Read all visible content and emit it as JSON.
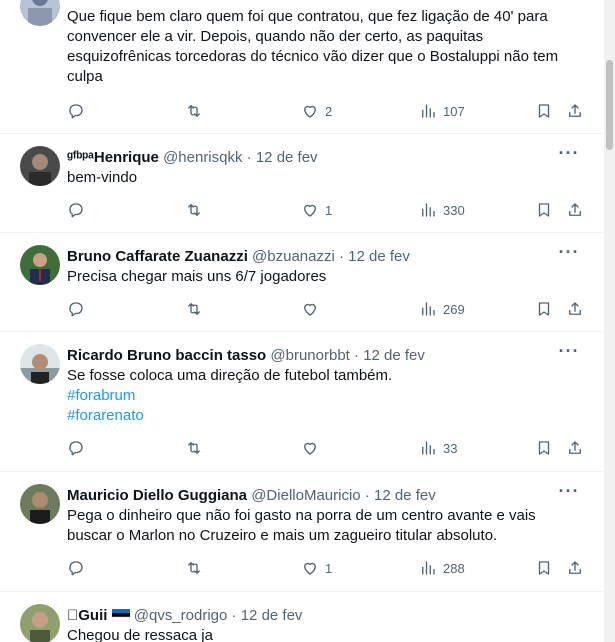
{
  "colors": {
    "text": "#0f1419",
    "muted": "#536471",
    "link": "#1d9bf0",
    "divider": "#eff3f4"
  },
  "tweets": [
    {
      "name": "",
      "handle": "",
      "date": "",
      "lines": [
        "Que fique bem claro quem foi que contratou, que fez ligação de 40' para",
        "convencer ele a vir. Depois, quando não der certo, as paquitas",
        "esquizofrênicas torcedoras do técnico vão dizer que o Bostaluppi não tem",
        "culpa"
      ],
      "tags": [],
      "likes": "2",
      "views": "107"
    },
    {
      "name": "ᵍᶠᵇᵖᵃHenrique",
      "handle": "@henrisqkk",
      "date": "12 de fev",
      "lines": [
        "bem-vindo"
      ],
      "tags": [],
      "likes": "1",
      "views": "330"
    },
    {
      "name": "Bruno Caffarate Zuanazzi",
      "handle": "@bzuanazzi",
      "date": "12 de fev",
      "lines": [
        "Precisa chegar mais uns 6/7 jogadores"
      ],
      "tags": [],
      "likes": "",
      "views": "269"
    },
    {
      "name": "Ricardo Bruno baccin tasso",
      "handle": "@brunorbbt",
      "date": "12 de fev",
      "lines": [
        "Se fosse coloca uma direção de futebol também."
      ],
      "tags": [
        "#forabrum",
        "#forarenato"
      ],
      "likes": "",
      "views": "33"
    },
    {
      "name": "Mauricio Diello Guggiana",
      "handle": "@DielloMauricio",
      "date": "12 de fev",
      "lines": [
        "Pega o dinheiro que não foi gasto na porra de um centro avante e vais",
        "buscar o Marlon no Cruzeiro e mais um zagueiro titular absoluto."
      ],
      "tags": [],
      "likes": "1",
      "views": "288"
    },
    {
      "name": "Guii",
      "handle": "@qvs_rodrigo",
      "date": "12 de fev",
      "lines": [
        "Chegou de ressaca ja"
      ],
      "tags": [],
      "likes": "",
      "views": ""
    }
  ],
  "sep": "·",
  "more_label": "···",
  "icons": [
    "reply-icon",
    "retweet-icon",
    "like-icon",
    "views-icon",
    "bookmark-icon",
    "share-icon"
  ]
}
